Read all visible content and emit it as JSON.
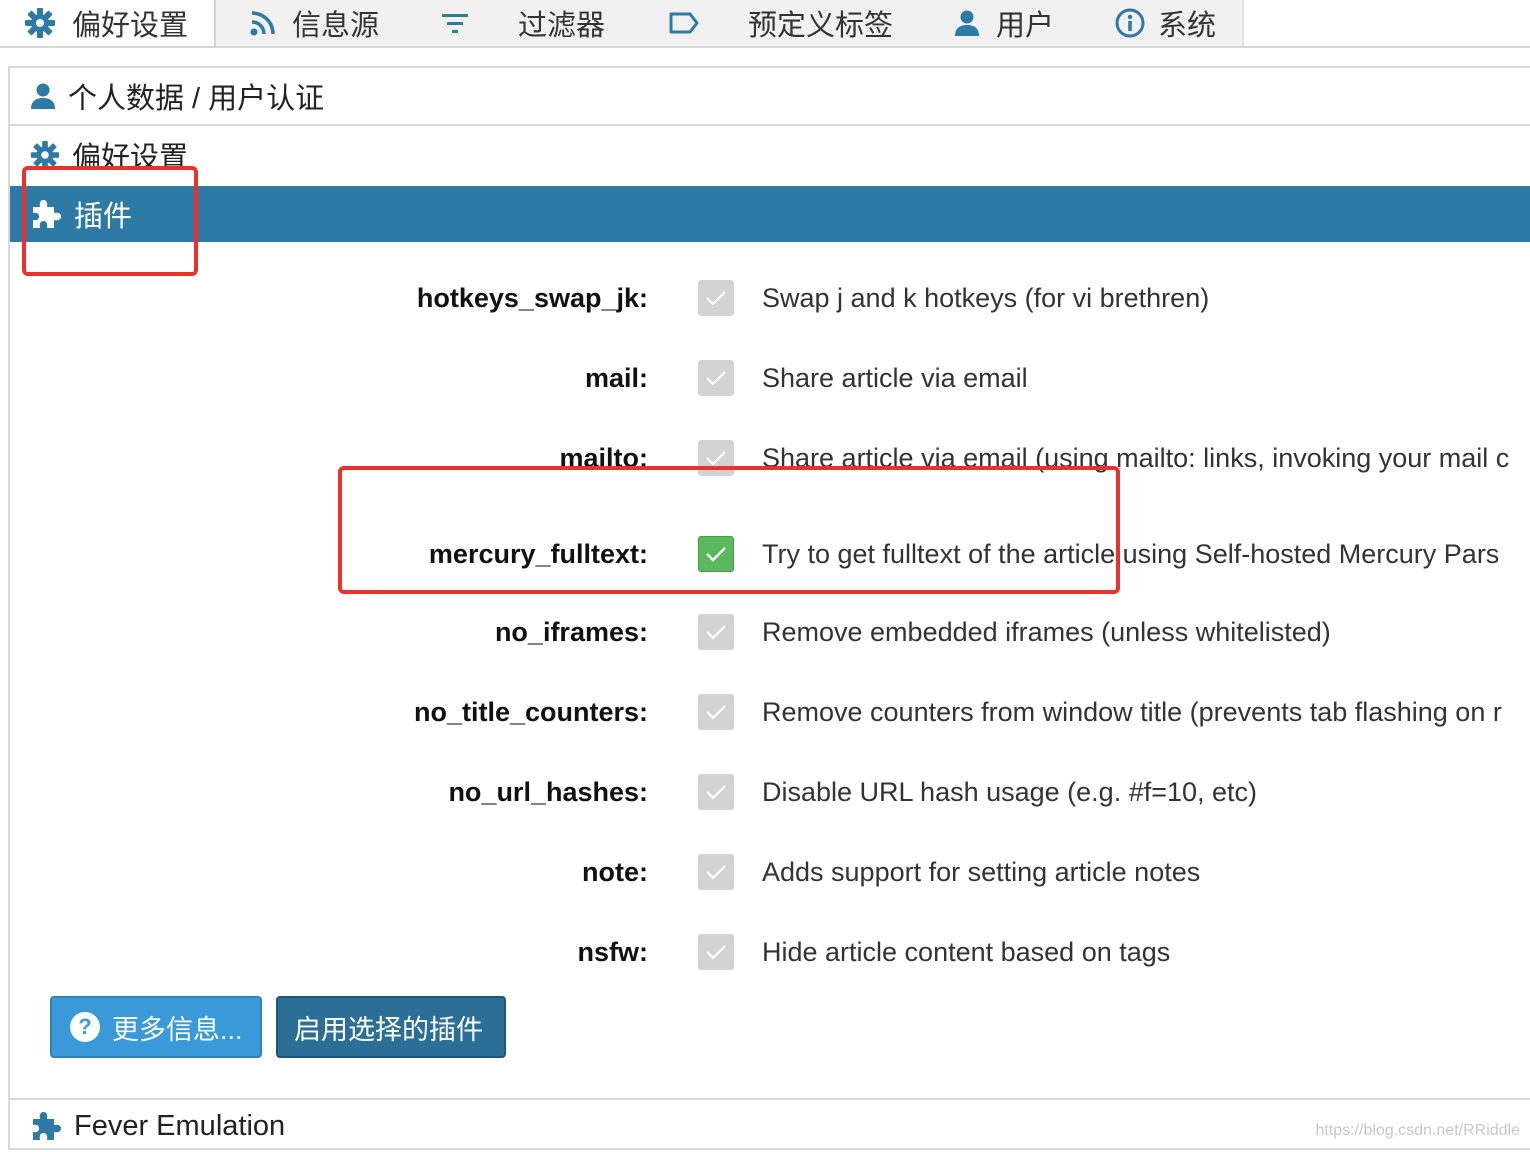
{
  "tabs": [
    {
      "label": "偏好设置",
      "icon": "gear-icon"
    },
    {
      "label": "信息源",
      "icon": "rss-icon"
    },
    {
      "label": "过滤器",
      "icon": "filter-icon"
    },
    {
      "label": "预定义标签",
      "icon": "label-icon"
    },
    {
      "label": "用户",
      "icon": "user-icon"
    },
    {
      "label": "系统",
      "icon": "info-icon"
    }
  ],
  "sections": {
    "profile": "个人数据 / 用户认证",
    "preferences": "偏好设置",
    "plugins": "插件",
    "fever": "Fever Emulation"
  },
  "plugins": [
    {
      "name": "hotkeys_swap_jk:",
      "desc": "Swap j and k hotkeys (for vi brethren)",
      "checked": false
    },
    {
      "name": "mail:",
      "desc": "Share article via email",
      "checked": false
    },
    {
      "name": "mailto:",
      "desc": "Share article via email (using mailto: links, invoking your mail c",
      "checked": false
    },
    {
      "name": "mercury_fulltext:",
      "desc": "Try to get fulltext of the article using Self-hosted Mercury Pars",
      "checked": true
    },
    {
      "name": "no_iframes:",
      "desc": "Remove embedded iframes (unless whitelisted)",
      "checked": false
    },
    {
      "name": "no_title_counters:",
      "desc": "Remove counters from window title (prevents tab flashing on r",
      "checked": false
    },
    {
      "name": "no_url_hashes:",
      "desc": "Disable URL hash usage (e.g. #f=10, etc)",
      "checked": false
    },
    {
      "name": "note:",
      "desc": "Adds support for setting article notes",
      "checked": false
    },
    {
      "name": "nsfw:",
      "desc": "Hide article content based on tags",
      "checked": false
    }
  ],
  "buttons": {
    "more_info": "更多信息...",
    "enable_selected": "启用选择的插件"
  },
  "colors": {
    "accent": "#2d7aa5",
    "checked": "#5cb85c",
    "unchecked": "#d3d3d3",
    "annotation": "#e8322b"
  },
  "watermark": "https://blog.csdn.net/RRiddle"
}
